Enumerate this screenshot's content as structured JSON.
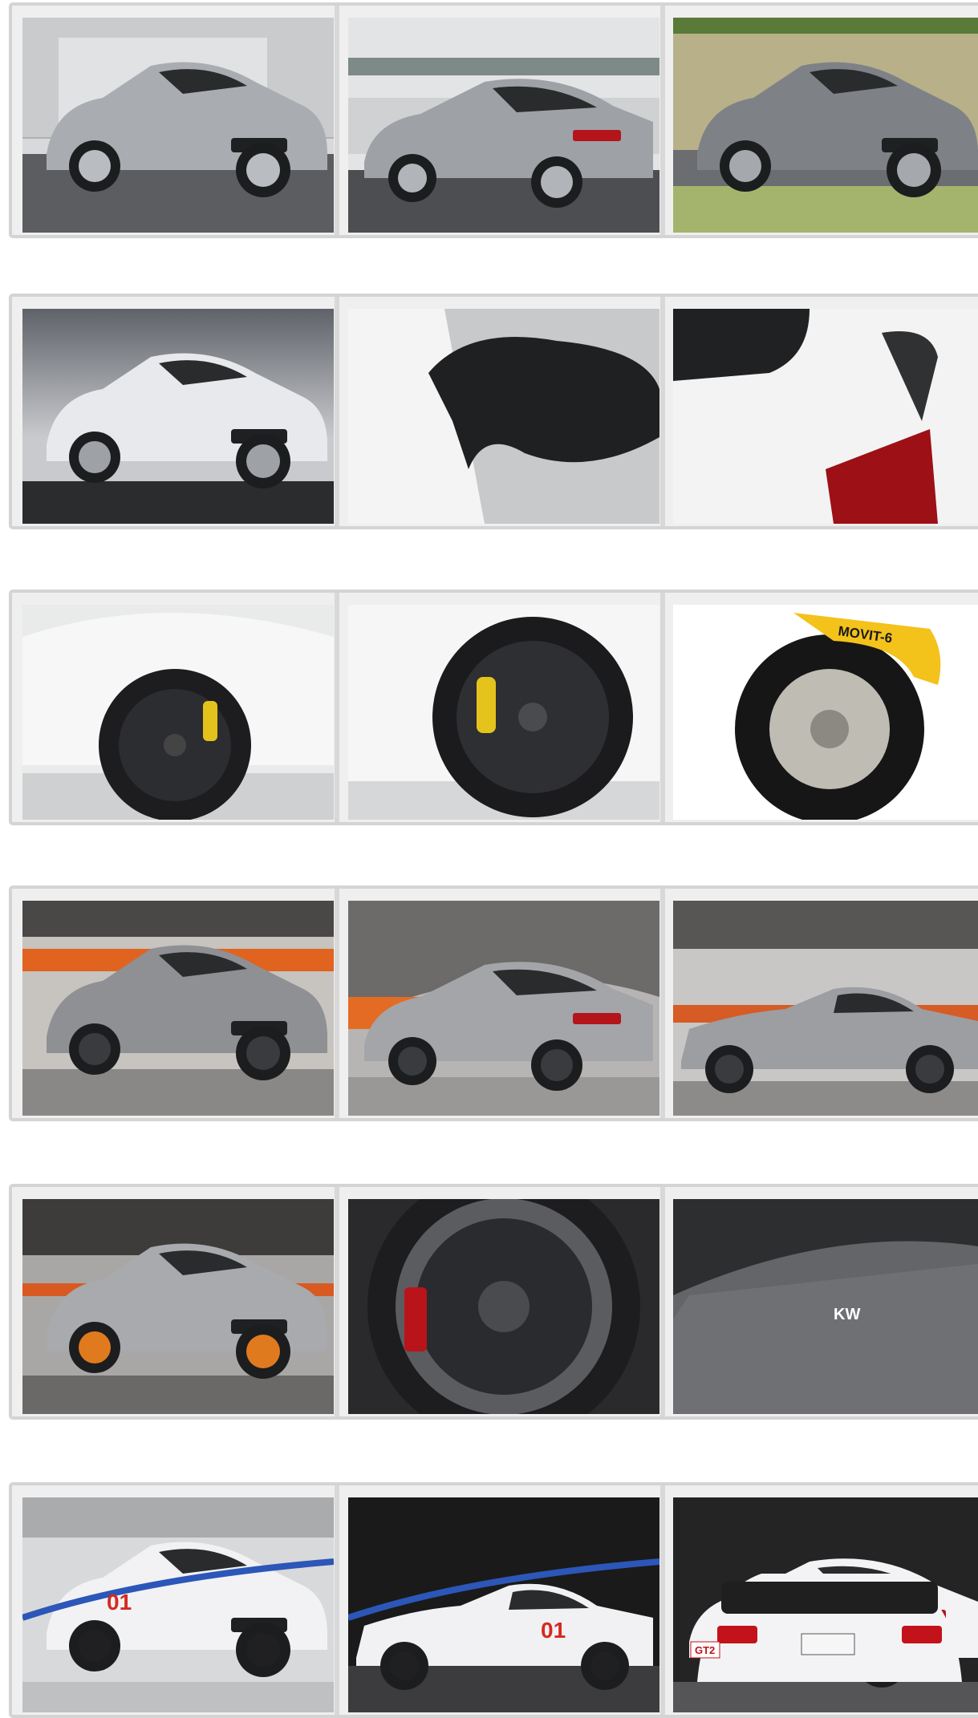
{
  "gallery": {
    "rows": [
      {
        "tiles": [
          {
            "name": "silver-bmw-m3-front-garage",
            "scene": "parking",
            "view": "front",
            "car": "#a9acb1",
            "wheel": "#b9bcc1"
          },
          {
            "name": "silver-bmw-m3-rear-building",
            "scene": "building",
            "view": "rear",
            "car": "#9ea2a7",
            "wheel": "#b1b4b9"
          },
          {
            "name": "grey-bmw-m3-road-grass",
            "scene": "grass",
            "view": "front",
            "car": "#7e8287",
            "wheel": "#a5a8ad"
          }
        ]
      },
      {
        "tiles": [
          {
            "name": "white-bmw-m3-studio",
            "scene": "studio",
            "view": "front",
            "car": "#e8e9ec",
            "wheel": "#9ea1a6"
          },
          {
            "name": "carbon-mirror-closeup",
            "scene": "mirror",
            "view": "detail",
            "car": "#f2f2f2",
            "wheel": "#222222"
          },
          {
            "name": "carbon-spoiler-closeup",
            "scene": "spoiler",
            "view": "detail",
            "car": "#f4f4f4",
            "wheel": "#b0141a"
          }
        ]
      },
      {
        "tiles": [
          {
            "name": "white-m3-black-wheel-yellow-caliper",
            "scene": "wheel-white",
            "view": "detail",
            "car": "#f5f5f5",
            "wheel": "#1d1d1f"
          },
          {
            "name": "black-wheel-yellow-caliper-closeup",
            "scene": "wheel-close",
            "view": "detail",
            "car": "#f7f7f7",
            "wheel": "#1b1b1d"
          },
          {
            "name": "movit-6-brake-disc",
            "scene": "brake",
            "view": "detail",
            "car": "#ffffff",
            "wheel": "#161616",
            "caption": "MOVIT-6"
          }
        ]
      },
      {
        "tiles": [
          {
            "name": "matte-m3-front-parking-garage",
            "scene": "garage-orange",
            "view": "front",
            "car": "#8e9094",
            "wheel": "#3a3b3e"
          },
          {
            "name": "matte-m3-rear-parking-garage",
            "scene": "garage-tunnel",
            "view": "rear",
            "car": "#a3a5a9",
            "wheel": "#3a3b3e"
          },
          {
            "name": "matte-m3-side-parking-garage",
            "scene": "garage-side",
            "view": "side",
            "car": "#9c9ea2",
            "wheel": "#3a3b3e"
          }
        ]
      },
      {
        "tiles": [
          {
            "name": "matte-m3-orange-brakes-motion",
            "scene": "motion",
            "view": "front",
            "car": "#a8aaae",
            "wheel": "#e07a1e"
          },
          {
            "name": "grey-spoke-wheel-closeup",
            "scene": "rim",
            "view": "detail",
            "car": "#5a5c60",
            "wheel": "#2a2b2e"
          },
          {
            "name": "matte-hood-kw-decal",
            "scene": "hood",
            "view": "detail",
            "car": "#6e7074",
            "wheel": "#ffffff"
          }
        ]
      },
      {
        "tiles": [
          {
            "name": "ghaus-m3-race-car-front",
            "scene": "race-garage",
            "view": "front",
            "car": "#f2f2f4",
            "wheel": "#202022",
            "caption": "01"
          },
          {
            "name": "ghaus-m3-race-car-side-dark",
            "scene": "race-dark",
            "view": "side",
            "car": "#f1f1f3",
            "wheel": "#202022",
            "caption": "01"
          },
          {
            "name": "gt2-m3-race-car-rear",
            "scene": "race-rear",
            "view": "rear",
            "car": "#f3f3f5",
            "wheel": "#202022",
            "caption": "GT2"
          }
        ]
      }
    ]
  }
}
